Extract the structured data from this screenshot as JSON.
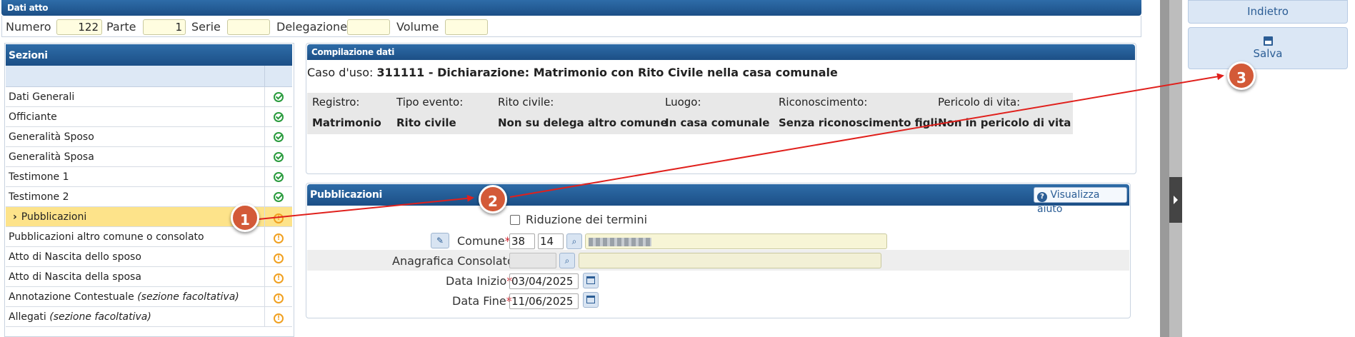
{
  "dati_atto": {
    "title": "Dati atto",
    "numero_label": "Numero",
    "numero_value": "122",
    "parte_label": "Parte",
    "parte_value": "1",
    "serie_label": "Serie",
    "serie_value": "",
    "delegazione_label": "Delegazione",
    "delegazione_value": "",
    "volume_label": "Volume",
    "volume_value": ""
  },
  "sezioni": {
    "title": "Sezioni",
    "items": [
      {
        "label": "Dati Generali",
        "status": "ok"
      },
      {
        "label": "Officiante",
        "status": "ok"
      },
      {
        "label": "Generalità Sposo",
        "status": "ok"
      },
      {
        "label": "Generalità Sposa",
        "status": "ok"
      },
      {
        "label": "Testimone 1",
        "status": "ok"
      },
      {
        "label": "Testimone 2",
        "status": "ok"
      },
      {
        "label": "Pubblicazioni",
        "status": "warning",
        "selected": true
      },
      {
        "label": "Pubblicazioni altro comune o consolato",
        "status": "warning"
      },
      {
        "label": "Atto di Nascita dello sposo",
        "status": "warning"
      },
      {
        "label": "Atto di Nascita della sposa",
        "status": "warning"
      },
      {
        "label": "Annotazione Contestuale",
        "italic_suffix": "(sezione facoltativa)",
        "status": "warning"
      },
      {
        "label": "Allegati",
        "italic_suffix": "(sezione facoltativa)",
        "status": "warning"
      }
    ]
  },
  "compilazione": {
    "title": "Compilazione dati",
    "caso_label": "Caso d'uso:",
    "caso_value": "311111 - Dichiarazione: Matrimonio con Rito Civile nella casa comunale",
    "headers": [
      "Registro:",
      "Tipo evento:",
      "Rito civile:",
      "Luogo:",
      "Riconoscimento:",
      "Pericolo di vita:"
    ],
    "values": [
      "Matrimonio",
      "Rito civile",
      "Non su delega altro comune",
      "In casa comunale",
      "Senza riconoscimento figli",
      "Non in pericolo di vita"
    ]
  },
  "pubblicazioni": {
    "title": "Pubblicazioni",
    "help_label": "Visualizza aiuto",
    "riduzione_label": "Riduzione dei termini",
    "comune_label": "Comune",
    "comune_code1": "38",
    "comune_code2": "14",
    "consolato_label": "Anagrafica Consolato",
    "data_inizio_label": "Data Inizio",
    "data_inizio_value": "03/04/2025",
    "data_fine_label": "Data Fine",
    "data_fine_value": "11/06/2025",
    "required_mark": "*"
  },
  "actions": {
    "indietro_label": "Indietro",
    "salva_label": "Salva"
  },
  "annotations": {
    "step1": "1",
    "step2": "2",
    "step3": "3"
  },
  "colors": {
    "header_blue": "#1f5a96",
    "selected_row": "#fde38a",
    "ok_green": "#2a9b3d",
    "warning_orange": "#f0a020",
    "arrow_red": "#e0201c",
    "step_badge": "#d35a38"
  }
}
